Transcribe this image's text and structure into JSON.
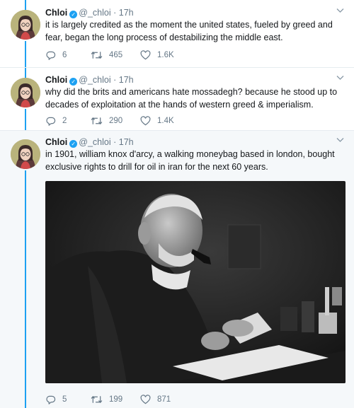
{
  "tweets": [
    {
      "name": "Chloi",
      "handle": "@_chloi",
      "time": "17h",
      "text": "it is largely credited as the moment the united states, fueled by greed and fear, began the long process of destabilizing the middle east.",
      "replies": "6",
      "retweets": "465",
      "likes": "1.6K"
    },
    {
      "name": "Chloi",
      "handle": "@_chloi",
      "time": "17h",
      "text": "why did the brits and americans hate mossadegh? because he stood up to decades of exploitation at the hands of western greed & imperialism.",
      "replies": "2",
      "retweets": "290",
      "likes": "1.4K"
    },
    {
      "name": "Chloi",
      "handle": "@_chloi",
      "time": "17h",
      "text": "in 1901, william knox d'arcy, a walking moneybag based in london, bought exclusive rights to drill for oil in iran for the next 60 years.",
      "replies": "5",
      "retweets": "199",
      "likes": "871"
    }
  ],
  "separator": "·",
  "icons": {
    "verified": "verified-badge-icon",
    "caret": "chevron-down-icon",
    "reply": "reply-icon",
    "retweet": "retweet-icon",
    "like": "heart-icon"
  },
  "colors": {
    "thread_line": "#1da1f2",
    "verified": "#1da1f2",
    "meta_text": "#657786",
    "highlight_background": "#f5f8fa"
  }
}
